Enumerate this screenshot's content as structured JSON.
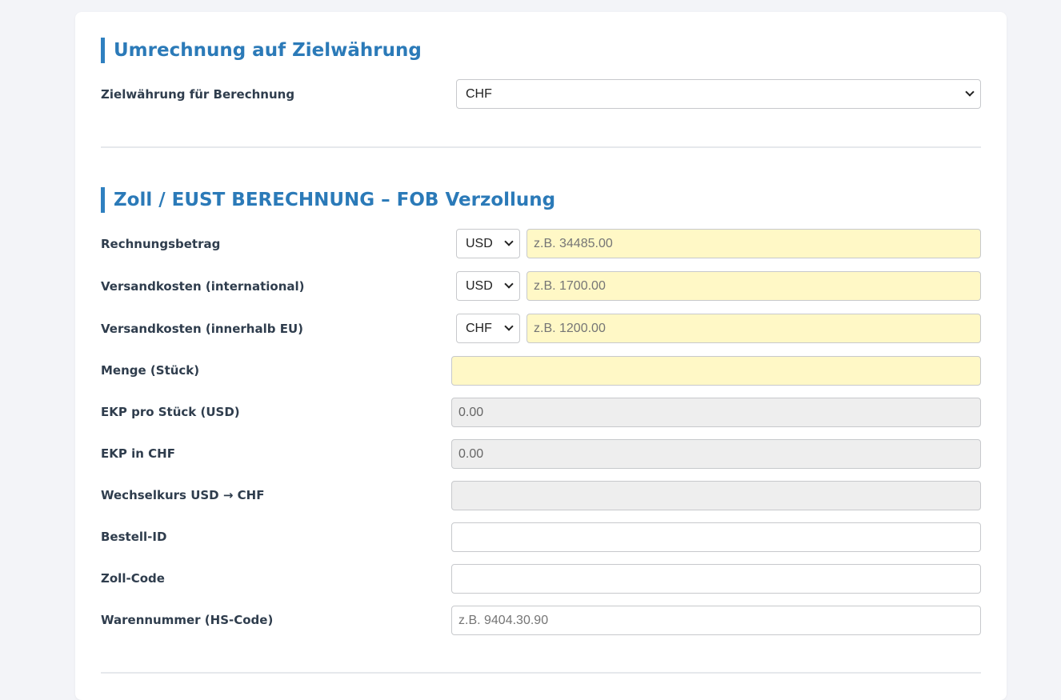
{
  "section1": {
    "title": "Umrechnung auf Zielwährung",
    "target_label": "Zielwährung für Berechnung",
    "target_value": "CHF"
  },
  "section2": {
    "title": "Zoll / EUST BERECHNUNG – FOB Verzollung",
    "rows": [
      {
        "label": "Rechnungsbetrag",
        "currency": "USD",
        "placeholder": "z.B. 34485.00"
      },
      {
        "label": "Versandkosten (international)",
        "currency": "USD",
        "placeholder": "z.B. 1700.00"
      },
      {
        "label": "Versandkosten (innerhalb EU)",
        "currency": "CHF",
        "placeholder": "z.B. 1200.00"
      }
    ],
    "menge": {
      "label": "Menge (Stück)",
      "value": ""
    },
    "ekp_usd": {
      "label": "EKP pro Stück (USD)",
      "value": "0.00"
    },
    "ekp_chf": {
      "label": "EKP in CHF",
      "value": "0.00"
    },
    "wechselkurs": {
      "label": "Wechselkurs USD → CHF",
      "value": ""
    },
    "bestell_id": {
      "label": "Bestell-ID",
      "value": ""
    },
    "zoll_code": {
      "label": "Zoll-Code",
      "value": ""
    },
    "hs_code": {
      "label": "Warennummer (HS-Code)",
      "placeholder": "z.B. 9404.30.90"
    }
  }
}
